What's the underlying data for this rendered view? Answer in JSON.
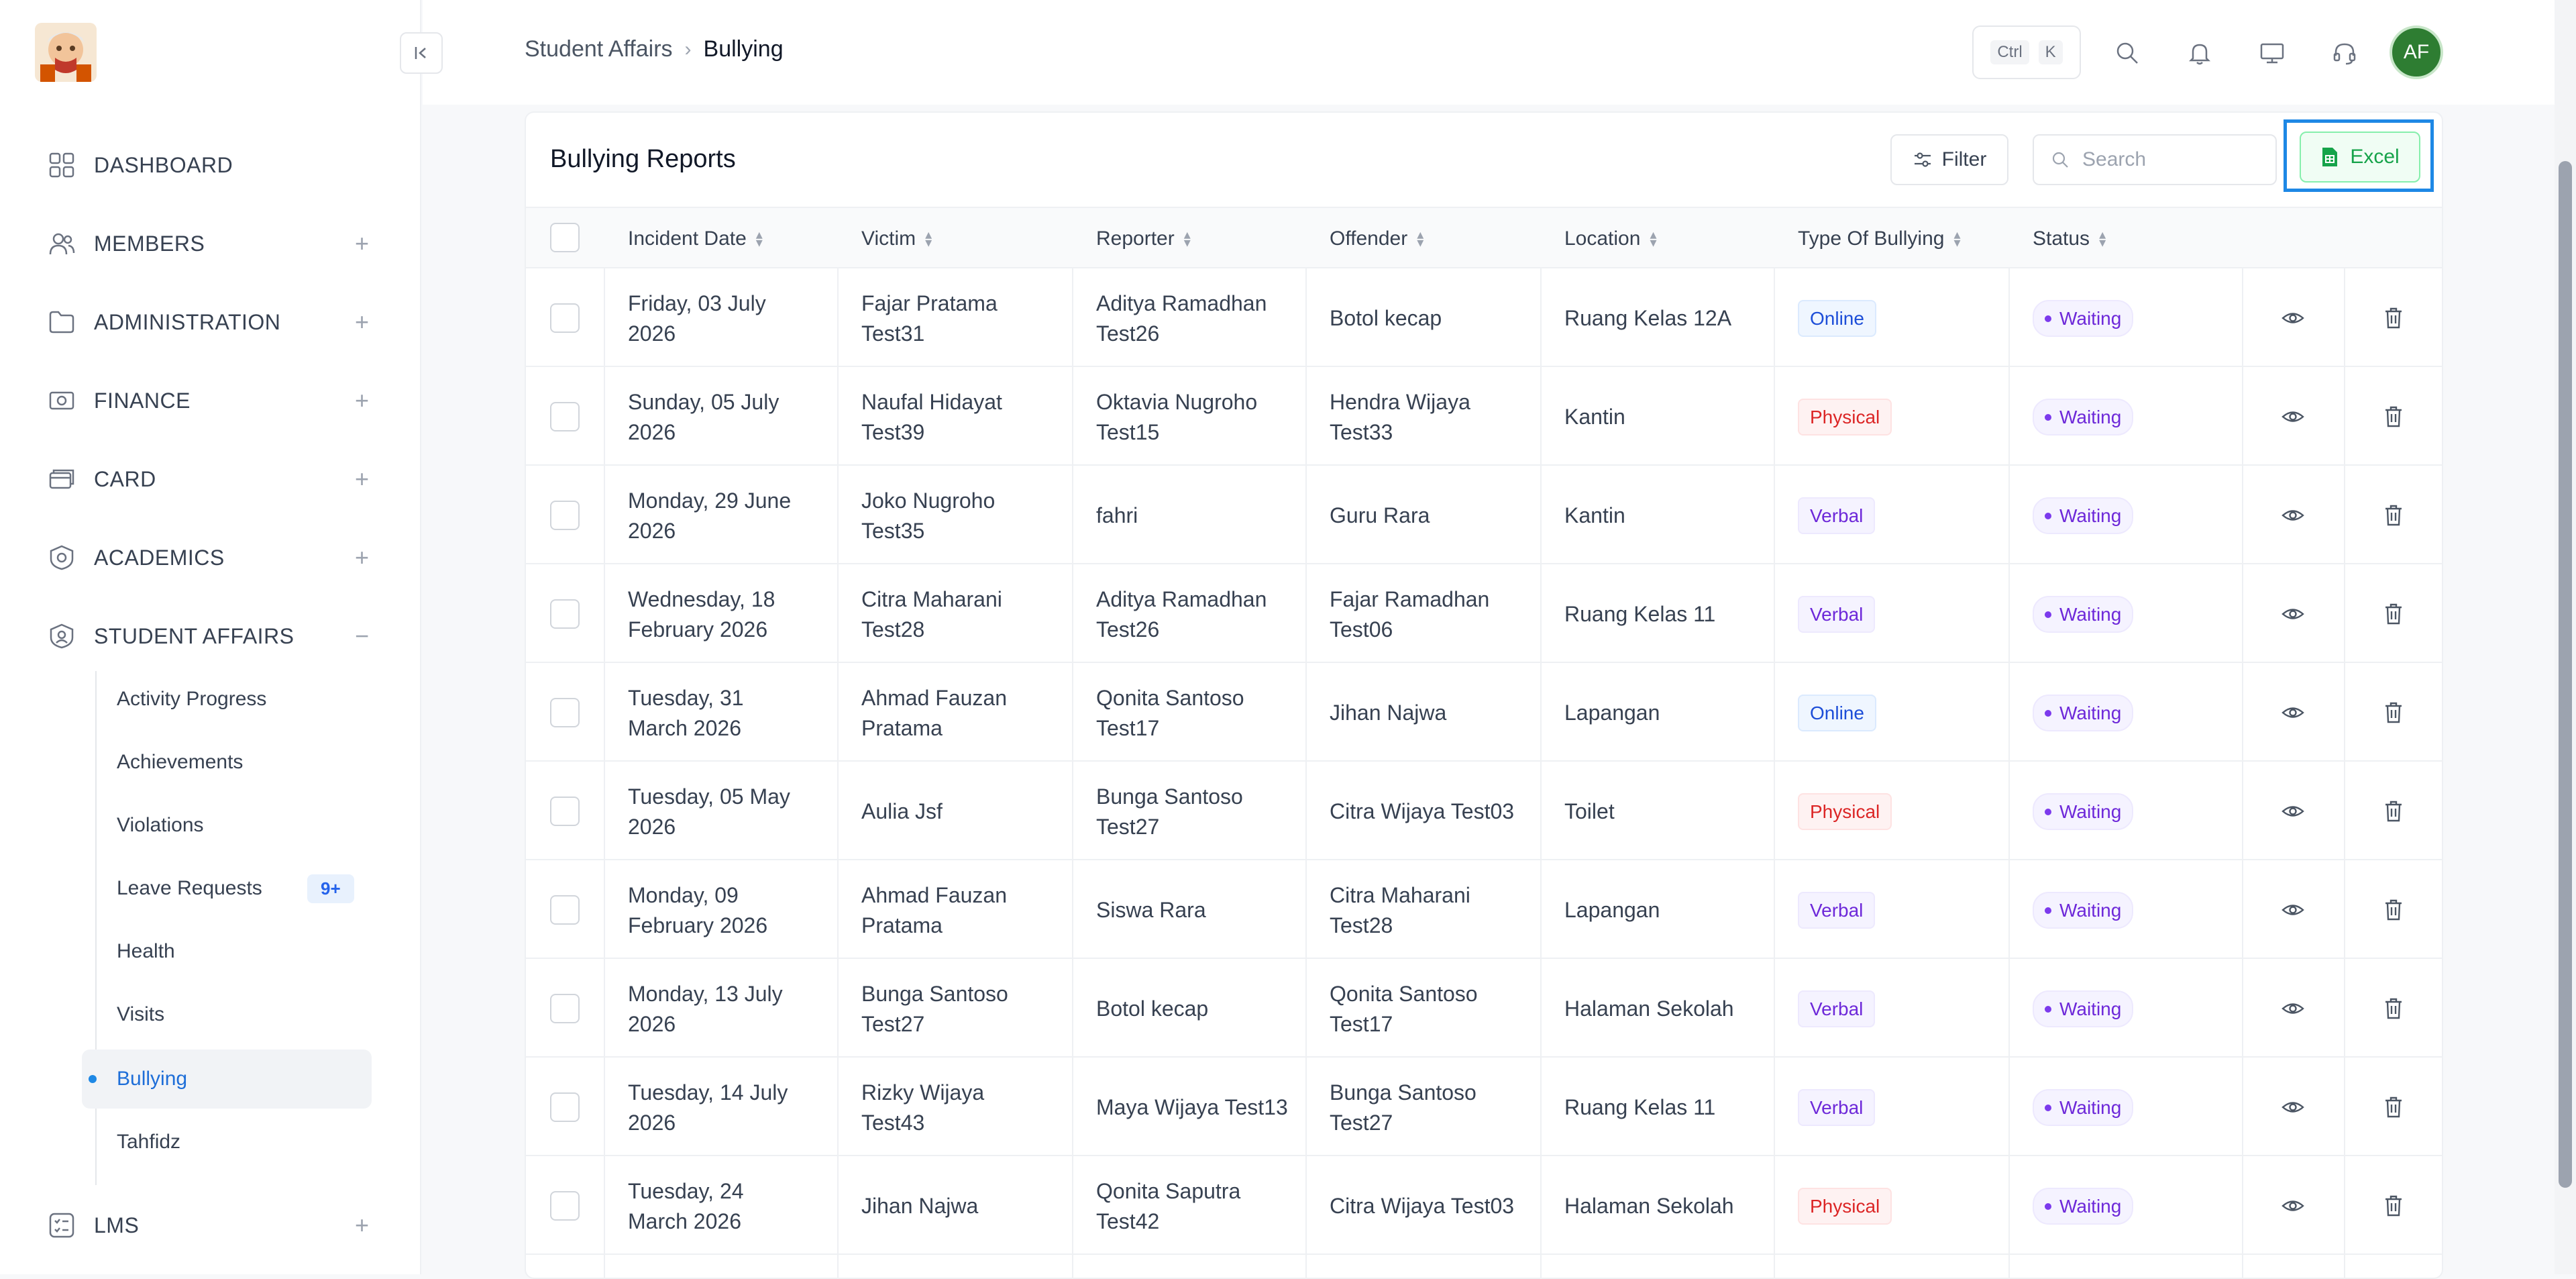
{
  "topbar": {
    "breadcrumb_parent": "Student Affairs",
    "breadcrumb_current": "Bullying",
    "shortcut_ctrl": "Ctrl",
    "shortcut_key": "K",
    "avatar_initials": "AF"
  },
  "sidebar": {
    "items": [
      {
        "label": "DASHBOARD",
        "icon": "dashboard-icon"
      },
      {
        "label": "MEMBERS",
        "icon": "members-icon",
        "toggle": "+"
      },
      {
        "label": "ADMINISTRATION",
        "icon": "folder-icon",
        "toggle": "+"
      },
      {
        "label": "FINANCE",
        "icon": "finance-icon",
        "toggle": "+"
      },
      {
        "label": "CARD",
        "icon": "card-icon",
        "toggle": "+"
      },
      {
        "label": "ACADEMICS",
        "icon": "academics-icon",
        "toggle": "+"
      },
      {
        "label": "STUDENT AFFAIRS",
        "icon": "student-affairs-icon",
        "toggle": "−"
      },
      {
        "label": "LMS",
        "icon": "lms-icon",
        "toggle": "+"
      }
    ],
    "sub_items": [
      {
        "label": "Activity Progress"
      },
      {
        "label": "Achievements"
      },
      {
        "label": "Violations"
      },
      {
        "label": "Leave Requests",
        "badge": "9+"
      },
      {
        "label": "Health"
      },
      {
        "label": "Visits"
      },
      {
        "label": "Bullying",
        "active": true
      },
      {
        "label": "Tahfidz"
      }
    ]
  },
  "main": {
    "title": "Bullying Reports",
    "filter_label": "Filter",
    "search_placeholder": "Search",
    "excel_label": "Excel",
    "columns": [
      "Incident Date",
      "Victim",
      "Reporter",
      "Offender",
      "Location",
      "Type Of Bullying",
      "Status"
    ],
    "rows": [
      {
        "date": "Friday, 03 July 2026",
        "victim": "Fajar Pratama Test31",
        "reporter": "Aditya Ramadhan Test26",
        "offender": "Botol kecap",
        "location": "Ruang Kelas 12A",
        "type": "Online",
        "status": "Waiting"
      },
      {
        "date": "Sunday, 05 July 2026",
        "victim": "Naufal Hidayat Test39",
        "reporter": "Oktavia Nugroho Test15",
        "offender": "Hendra Wijaya Test33",
        "location": "Kantin",
        "type": "Physical",
        "status": "Waiting"
      },
      {
        "date": "Monday, 29 June 2026",
        "victim": "Joko Nugroho Test35",
        "reporter": "fahri",
        "offender": "Guru Rara",
        "location": "Kantin",
        "type": "Verbal",
        "status": "Waiting"
      },
      {
        "date": "Wednesday, 18 February 2026",
        "victim": "Citra Maharani Test28",
        "reporter": "Aditya Ramadhan Test26",
        "offender": "Fajar Ramadhan Test06",
        "location": "Ruang Kelas 11",
        "type": "Verbal",
        "status": "Waiting"
      },
      {
        "date": "Tuesday, 31 March 2026",
        "victim": "Ahmad Fauzan Pratama",
        "reporter": "Qonita Santoso Test17",
        "offender": "Jihan Najwa",
        "location": "Lapangan",
        "type": "Online",
        "status": "Waiting"
      },
      {
        "date": "Tuesday, 05 May 2026",
        "victim": "Aulia Jsf",
        "reporter": "Bunga Santoso Test27",
        "offender": "Citra Wijaya Test03",
        "location": "Toilet",
        "type": "Physical",
        "status": "Waiting"
      },
      {
        "date": "Monday, 09 February 2026",
        "victim": "Ahmad Fauzan Pratama",
        "reporter": "Siswa Rara",
        "offender": "Citra Maharani Test28",
        "location": "Lapangan",
        "type": "Verbal",
        "status": "Waiting"
      },
      {
        "date": "Monday, 13 July 2026",
        "victim": "Bunga Santoso Test27",
        "reporter": "Botol kecap",
        "offender": "Qonita Santoso Test17",
        "location": "Halaman Sekolah",
        "type": "Verbal",
        "status": "Waiting"
      },
      {
        "date": "Tuesday, 14 July 2026",
        "victim": "Rizky Wijaya Test43",
        "reporter": "Maya Wijaya Test13",
        "offender": "Bunga Santoso Test27",
        "location": "Ruang Kelas 11",
        "type": "Verbal",
        "status": "Waiting"
      },
      {
        "date": "Tuesday, 24 March 2026",
        "victim": "Jihan Najwa",
        "reporter": "Qonita Saputra Test42",
        "offender": "Citra Wijaya Test03",
        "location": "Halaman Sekolah",
        "type": "Physical",
        "status": "Waiting"
      }
    ]
  },
  "colors": {
    "accent": "#1e88e5",
    "excel_green": "#16a34a",
    "status_purple": "#6d28d9",
    "online_blue": "#1d4ed8",
    "physical_red": "#dc2626",
    "avatar_green": "#2e7d32"
  }
}
